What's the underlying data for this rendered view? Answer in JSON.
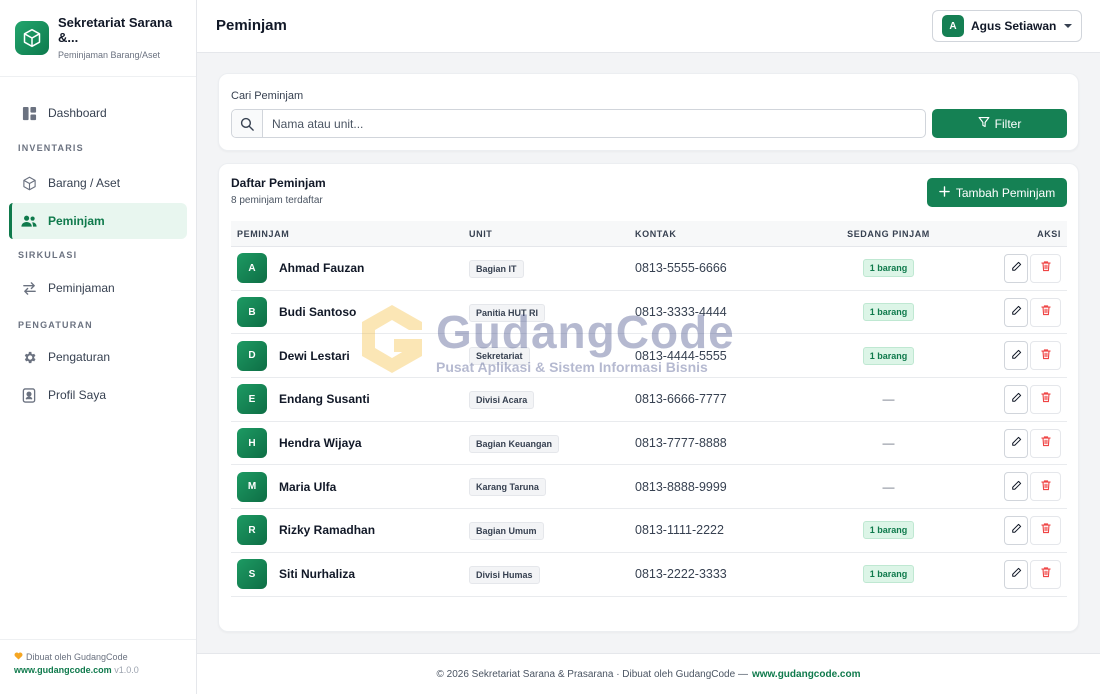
{
  "brand": {
    "title": "Sekretariat Sarana &...",
    "subtitle": "Peminjaman Barang/Aset"
  },
  "sidebar": {
    "items": [
      {
        "label": "Dashboard",
        "icon": "dashboard-icon"
      },
      {
        "section": "INVENTARIS"
      },
      {
        "label": "Barang / Aset",
        "icon": "box-icon"
      },
      {
        "label": "Peminjam",
        "icon": "users-icon",
        "active": true
      },
      {
        "section": "SIRKULASI"
      },
      {
        "label": "Peminjaman",
        "icon": "swap-icon"
      },
      {
        "section": "PENGATURAN"
      },
      {
        "label": "Pengaturan",
        "icon": "gear-icon"
      },
      {
        "label": "Profil Saya",
        "icon": "profile-icon"
      }
    ],
    "footer_line1": "Dibuat oleh GudangCode",
    "footer_site": "www.gudangcode.com",
    "footer_version": "v1.0.0"
  },
  "header": {
    "title": "Peminjam",
    "user_initial": "A",
    "user_name": "Agus Setiawan"
  },
  "search": {
    "label": "Cari Peminjam",
    "placeholder": "Nama atau unit...",
    "value": "",
    "filter_label": "Filter"
  },
  "list": {
    "title": "Daftar Peminjam",
    "subtitle": "8 peminjam terdaftar",
    "add_label": "Tambah Peminjam",
    "columns": [
      "PEMINJAM",
      "UNIT",
      "KONTAK",
      "SEDANG PINJAM",
      "AKSI"
    ],
    "rows": [
      {
        "initial": "A",
        "name": "Ahmad Fauzan",
        "unit": "Bagian IT",
        "kontak": "0813-5555-6666",
        "pinjam": "1 barang"
      },
      {
        "initial": "B",
        "name": "Budi Santoso",
        "unit": "Panitia HUT RI",
        "kontak": "0813-3333-4444",
        "pinjam": "1 barang"
      },
      {
        "initial": "D",
        "name": "Dewi Lestari",
        "unit": "Sekretariat",
        "kontak": "0813-4444-5555",
        "pinjam": "1 barang"
      },
      {
        "initial": "E",
        "name": "Endang Susanti",
        "unit": "Divisi Acara",
        "kontak": "0813-6666-7777",
        "pinjam": "—"
      },
      {
        "initial": "H",
        "name": "Hendra Wijaya",
        "unit": "Bagian Keuangan",
        "kontak": "0813-7777-8888",
        "pinjam": "—"
      },
      {
        "initial": "M",
        "name": "Maria Ulfa",
        "unit": "Karang Taruna",
        "kontak": "0813-8888-9999",
        "pinjam": "—"
      },
      {
        "initial": "R",
        "name": "Rizky Ramadhan",
        "unit": "Bagian Umum",
        "kontak": "0813-1111-2222",
        "pinjam": "1 barang"
      },
      {
        "initial": "S",
        "name": "Siti Nurhaliza",
        "unit": "Divisi Humas",
        "kontak": "0813-2222-3333",
        "pinjam": "1 barang"
      }
    ]
  },
  "footer": {
    "text": "© 2026 Sekretariat Sarana & Prasarana · Dibuat oleh GudangCode —",
    "site": "www.gudangcode.com"
  },
  "watermark": {
    "title": "GudangCode",
    "subtitle": "Pusat Aplikasi & Sistem Informasi Bisnis"
  },
  "colors": {
    "accent": "#158154",
    "accent_light": "#e8f6ef",
    "danger": "#ef4444"
  }
}
